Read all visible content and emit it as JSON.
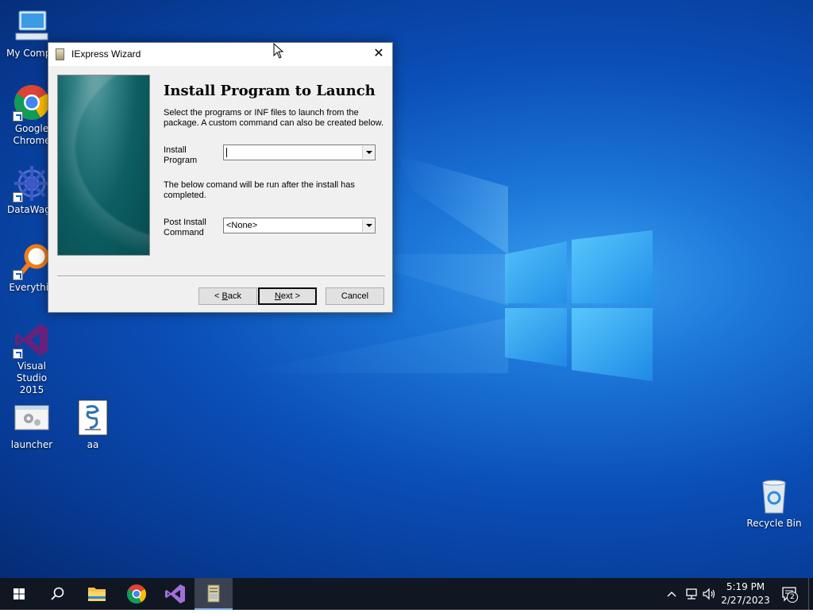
{
  "desktop": {
    "icons": [
      {
        "label": "My Compu",
        "icon": "computer-icon"
      },
      {
        "label": "Google Chrome",
        "icon": "chrome-icon"
      },
      {
        "label": "DataWago",
        "icon": "datawagon-icon"
      },
      {
        "label": "Everythin",
        "icon": "everything-search-icon"
      },
      {
        "label": "Visual Studio 2015",
        "icon": "visual-studio-icon"
      },
      {
        "label": "launcher",
        "icon": "launcher-icon"
      },
      {
        "label": "aa",
        "icon": "script-file-icon"
      },
      {
        "label": "Recycle Bin",
        "icon": "recycle-bin-icon"
      }
    ]
  },
  "dialog": {
    "title": "IExpress Wizard",
    "close_glyph": "✕",
    "heading": "Install Program to Launch",
    "description_line1": "Select the programs or INF files to launch from the",
    "description_line2": "package.  A custom command can also be created below.",
    "install_label_line1": "Install",
    "install_label_line2": "Program",
    "install_value": "",
    "post_description_line1": "The below comand will be run after the install has",
    "post_description_line2": "completed.",
    "post_label_line1": "Post Install",
    "post_label_line2": "Command",
    "post_value": "<None>",
    "buttons": {
      "back_prefix": "< ",
      "back_key": "B",
      "back_rest": "ack",
      "next_key": "N",
      "next_rest": "ext >",
      "cancel": "Cancel"
    }
  },
  "taskbar": {
    "items": [
      "start-icon",
      "search-icon",
      "file-explorer-icon",
      "chrome-icon",
      "visual-studio-icon",
      "iexpress-icon"
    ],
    "tray": {
      "time": "5:19 PM",
      "date": "2/27/2023",
      "notification_count": "2"
    }
  },
  "colors": {
    "desktop_blue": "#0b4fb8",
    "taskbar": "#101722",
    "dialog_bg": "#f0f0f0",
    "banner_teal": "#0d5f63"
  }
}
